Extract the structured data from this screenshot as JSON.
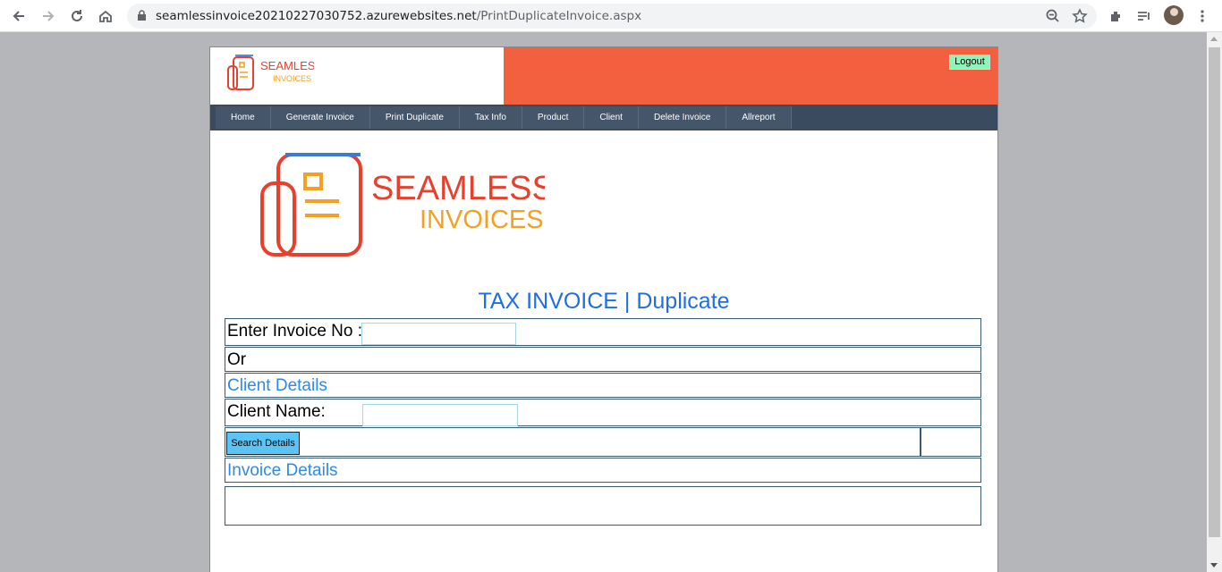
{
  "browser": {
    "url_host": "seamlessinvoice20210227030752.azurewebsites.net",
    "url_path": "/PrintDuplicateInvoice.aspx",
    "icons": [
      "back-icon",
      "forward-icon",
      "reload-icon",
      "home-icon",
      "lock-icon",
      "zoom-icon",
      "star-icon",
      "extensions-icon",
      "reading-list-icon",
      "profile-avatar",
      "menu-icon"
    ]
  },
  "header": {
    "logo_line1": "SEAMLESS",
    "logo_line2": "INVOICES",
    "logout_label": "Logout",
    "accent_color": "#f26040"
  },
  "nav": {
    "items": [
      "Home",
      "Generate Invoice",
      "Print Duplicate",
      "Tax Info",
      "Product",
      "Client",
      "Delete Invoice",
      "Allreport"
    ]
  },
  "brand": {
    "line1": "SEAMLESS",
    "line2": "INVOICES",
    "line1_color": "#e8402c",
    "line2_color": "#f5a020"
  },
  "main": {
    "title": "TAX INVOICE | Duplicate",
    "invoice_no_label": "Enter Invoice No :",
    "invoice_no_value": "",
    "or_label": "Or",
    "client_details_heading": "Client Details",
    "client_name_label": "Client Name:",
    "client_name_value": "",
    "search_button_label": "Search Details",
    "invoice_details_heading": "Invoice Details"
  }
}
